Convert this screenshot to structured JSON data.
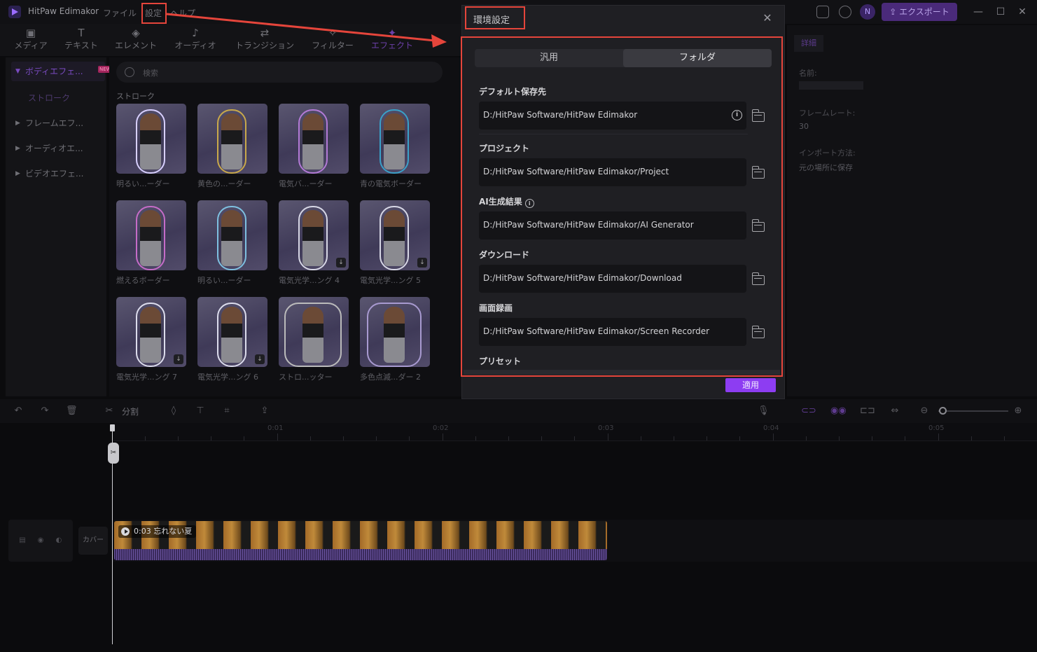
{
  "app": {
    "name": "HitPaw Edimakor",
    "menu": [
      "ファイル",
      "設定",
      "ヘルプ"
    ],
    "avatar_initial": "N",
    "export_label": "エクスポート"
  },
  "toolbar": {
    "tabs": [
      "メディア",
      "テキスト",
      "エレメント",
      "オーディオ",
      "トランジション",
      "フィルター",
      "エフェクト"
    ]
  },
  "sidebar": {
    "items": [
      "ボディエフェ...",
      "ストローク",
      "フレームエフ...",
      "オーディオエ...",
      "ビデオエフェ..."
    ],
    "new_badge": "NEW"
  },
  "effects": {
    "search_placeholder": "検索",
    "section": "ストローク",
    "items": [
      "明るい...ーダー",
      "黄色の...ーダー",
      "電気バ...ーダー",
      "青の電気ボーダー",
      "燃えるボーダー",
      "明るい...ーダー",
      "電気光学...ング 4",
      "電気光学...ング 5",
      "電気光学...ング 7",
      "電気光学...ング 6",
      "ストロ...ッター",
      "多色点滅...ダー 2"
    ]
  },
  "details": {
    "tab": "詳細",
    "name_label": "名前:",
    "framerate_label": "フレームレート:",
    "framerate_value": "30",
    "import_label": "インポート方法:",
    "import_value": "元の場所に保存"
  },
  "timeline": {
    "split_label": "分割",
    "ticks": [
      "0:01",
      "0:02",
      "0:03",
      "0:04",
      "0:05"
    ],
    "cover_label": "カバー",
    "clip_label": "0:03 忘れない夏"
  },
  "dialog": {
    "title": "環境設定",
    "tabs": [
      "汎用",
      "フォルダ"
    ],
    "active_tab": "フォルダ",
    "default_save_label": "デフォルト保存先",
    "default_save_path": "D:/HitPaw Software/HitPaw Edimakor",
    "project_label": "プロジェクト",
    "project_path": "D:/HitPaw Software/HitPaw Edimakor/Project",
    "ai_label": "AI生成結果",
    "ai_path": "D:/HitPaw Software/HitPaw Edimakor/AI Generator",
    "download_label": "ダウンロード",
    "download_path": "D:/HitPaw Software/HitPaw Edimakor/Download",
    "screen_label": "画面録画",
    "screen_path": "D:/HitPaw Software/HitPaw Edimakor/Screen Recorder",
    "preset_label": "プリセット",
    "apply_label": "適用"
  },
  "colors": {
    "accent": "#8d3df2",
    "highlight": "#e5453b"
  }
}
